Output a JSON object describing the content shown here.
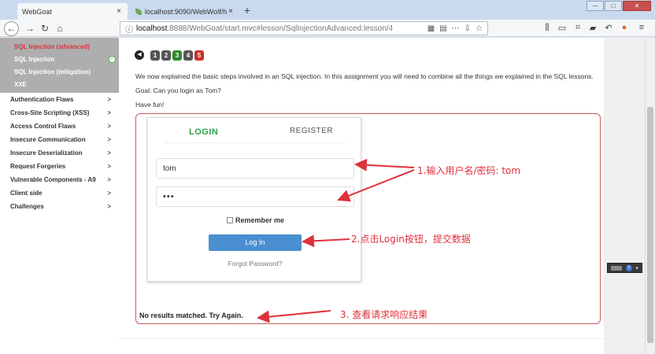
{
  "browser": {
    "tabs": [
      {
        "label": "WebGoat",
        "close": "×"
      },
      {
        "label": "localhost:9090/WebWolf/ho",
        "close": "×"
      }
    ],
    "new_tab": "+",
    "url_host": "localhost",
    "url_path": ":8888/WebGoat/start.mvc#lesson/SqlInjectionAdvanced.lesson/4",
    "window_controls": {
      "minimize": "─",
      "maximize": "□",
      "close": "✕"
    }
  },
  "sidebar": {
    "sub_items": [
      {
        "label": "SQL Injection (advanced)",
        "active": true
      },
      {
        "label": "SQL Injection",
        "completed": true
      },
      {
        "label": "SQL Injection (mitigation)"
      },
      {
        "label": "XXE"
      }
    ],
    "items": [
      {
        "label": "Authentication Flaws"
      },
      {
        "label": "Cross-Site Scripting (XSS)"
      },
      {
        "label": "Access Control Flaws"
      },
      {
        "label": "Insecure Communication"
      },
      {
        "label": "Insecure Deserialization"
      },
      {
        "label": "Request Forgeries"
      },
      {
        "label": "Vulnerable Components - A9"
      },
      {
        "label": "Client side"
      },
      {
        "label": "Challenges"
      }
    ]
  },
  "lesson": {
    "pages": [
      "1",
      "2",
      "3",
      "4",
      "5"
    ],
    "intro": "We now explained the basic steps involved in an SQL injection. In this assignment you will need to combine all the things we explained in the SQL lessons.",
    "goal": "Goal: Can you login as Tom?",
    "fun": "Have fun!"
  },
  "login_form": {
    "tab_login": "LOGIN",
    "tab_register": "REGISTER",
    "username_value": "tom",
    "password_value": "•••",
    "remember_label": "Remember me",
    "login_button": "Log In",
    "forgot_link": "Forgot Password?"
  },
  "feedback": "No results matched. Try Again.",
  "annotations": {
    "step1": "1.输入用户名/密码: tom",
    "step2": "2.点击Login按钮，提交数据",
    "step3": "3. 查看请求响应结果"
  },
  "colors": {
    "accent_red": "#e0303a",
    "login_green": "#2fa34a",
    "button_blue": "#4a90d0"
  }
}
